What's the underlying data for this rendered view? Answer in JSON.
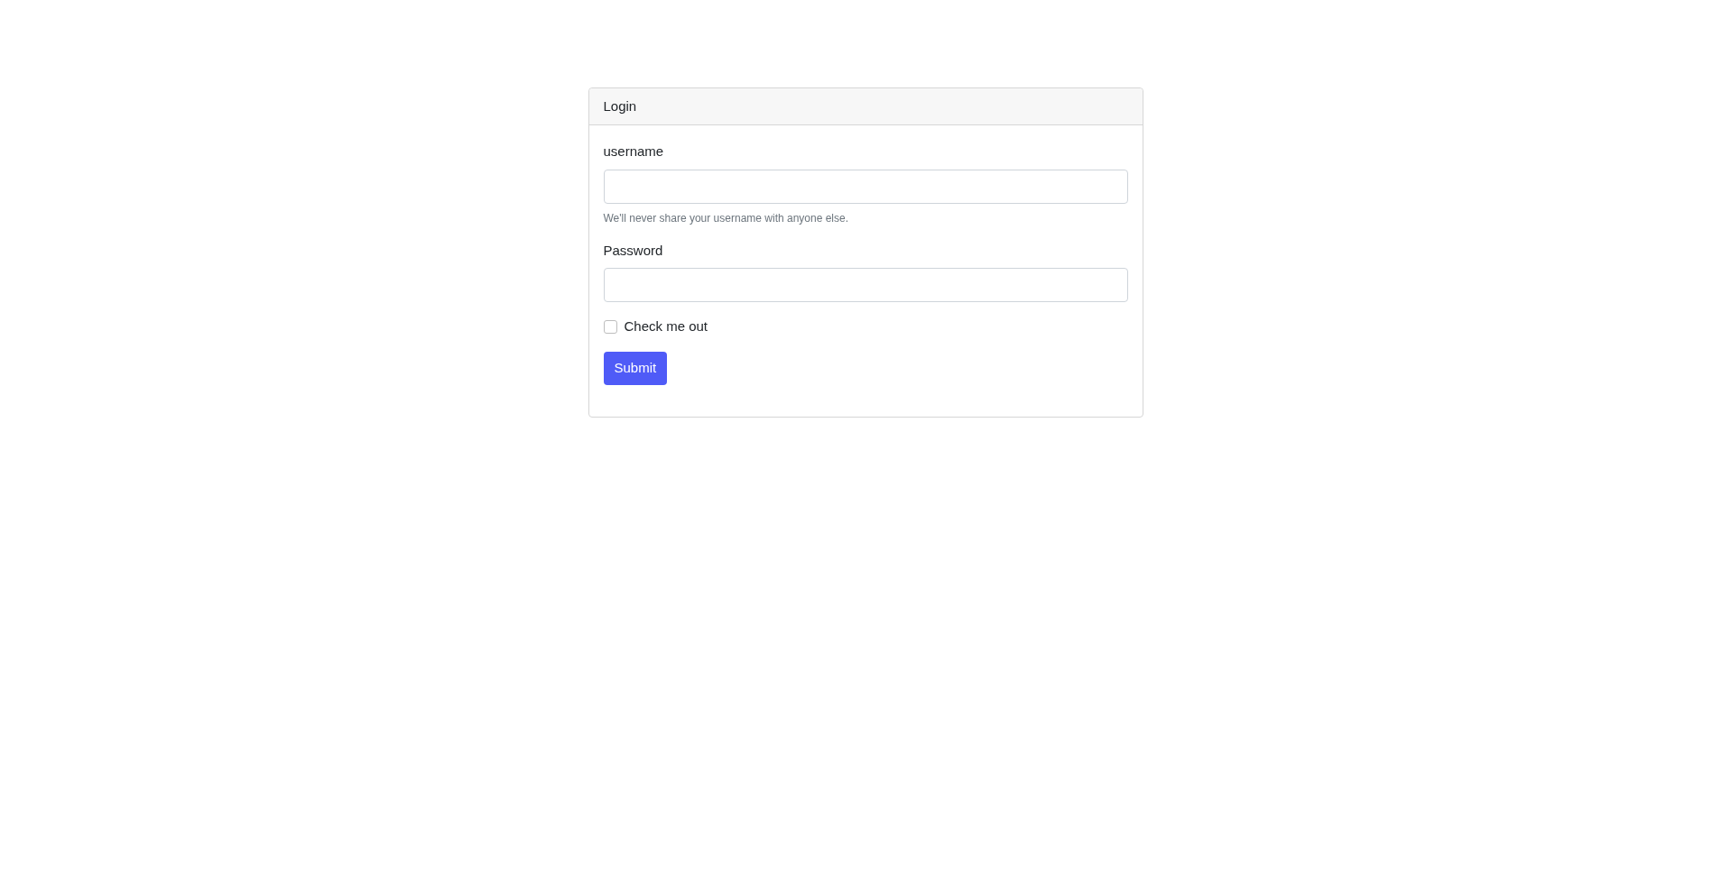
{
  "card": {
    "title": "Login"
  },
  "fields": [
    {
      "label": "username",
      "help": "We'll never share your username with anyone else."
    },
    {
      "label": "Password"
    }
  ],
  "checkbox": {
    "label": "Check me out",
    "checked": false
  },
  "submit": {
    "label": "Submit"
  }
}
